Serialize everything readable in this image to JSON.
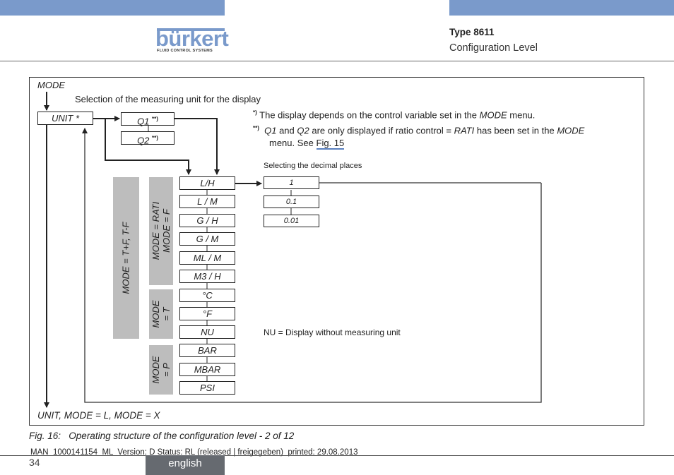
{
  "header": {
    "logo_name": "bürkert",
    "logo_tagline": "FLUID CONTROL SYSTEMS",
    "type_label": "Type 8611",
    "section_label": "Configuration Level",
    "accent_color": "#7a9acb"
  },
  "diagram": {
    "mode_label": "MODE",
    "selection_caption": "Selection of the measuring unit for the display",
    "unit_box": "UNIT *",
    "q1_box": "Q1",
    "q2_box": "Q2",
    "q_superscript": "**)",
    "footnote1_marker": "*)",
    "footnote1_text_a": "The display depends on the control variable set in the ",
    "footnote1_text_mode": "MODE",
    "footnote1_text_b": " menu.",
    "footnote2_marker": "**)",
    "footnote2_q1": "Q1",
    "footnote2_and": " and ",
    "footnote2_q2": "Q2",
    "footnote2_mid": " are only displayed if ratio control = ",
    "footnote2_rati": "RATI",
    "footnote2_tail": " has been set in the ",
    "footnote2_mode": "MODE",
    "footnote2_line2": "menu. See ",
    "footnote2_link": "Fig. 15",
    "decimal_caption": "Selecting the decimal places",
    "units": [
      "L/H",
      "L / M",
      "G / H",
      "G / M",
      "ML / M",
      "M3 / H",
      "°C",
      "°F",
      "NU",
      "BAR",
      "MBAR",
      "PSI"
    ],
    "decimals": [
      "1",
      "0.1",
      "0.01"
    ],
    "group_tf": "MODE = T+F, T-F",
    "group_rati_line1": "MODE = RATI",
    "group_rati_line2": "MODE = F",
    "group_t_line1": "MODE",
    "group_t_line2": "= T",
    "group_p_line1": "MODE",
    "group_p_line2": "= P",
    "nu_note": "NU = Display without measuring unit",
    "exit_label": "UNIT, MODE = L, MODE = X"
  },
  "caption": {
    "fig_label": "Fig. 16:",
    "fig_text": "Operating structure of the configuration level - 2 of 12"
  },
  "footer": {
    "doc_info": "MAN  1000141154  ML  Version: D Status: RL (released | freigegeben)  printed: 29.08.2013",
    "page_number": "34",
    "language": "english"
  }
}
